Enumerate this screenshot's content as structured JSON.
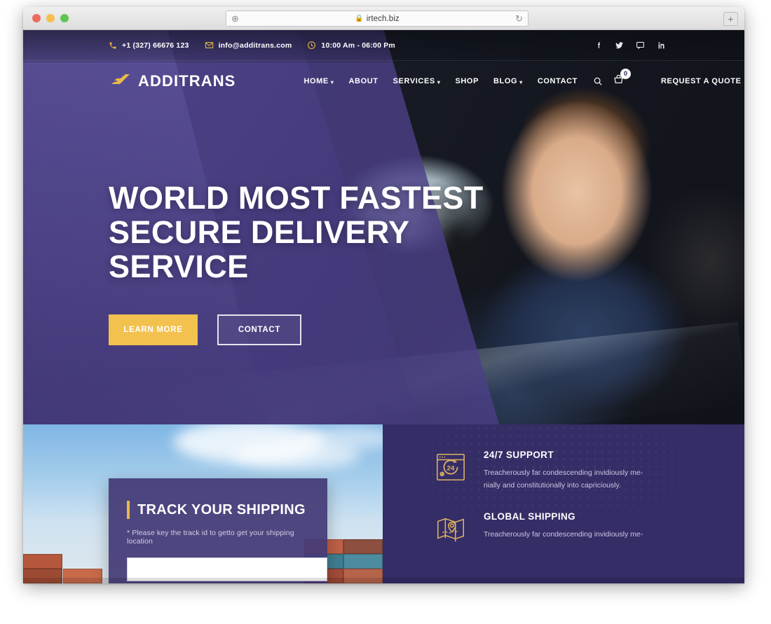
{
  "browser": {
    "url": "irtech.biz",
    "lock_icon": "lock-icon",
    "reload_icon": "reload-icon",
    "add_icon": "plus-circle-icon",
    "new_tab_icon": "plus-icon",
    "traffic_lights": [
      "close",
      "minimize",
      "maximize"
    ]
  },
  "topbar": {
    "contacts": [
      {
        "icon": "phone-icon",
        "label": "+1 (327) 66676 123"
      },
      {
        "icon": "envelope-icon",
        "label": "info@additrans.com"
      },
      {
        "icon": "clock-icon",
        "label": "10:00 Am - 06:00 Pm"
      }
    ],
    "social": [
      {
        "icon": "facebook-icon",
        "glyph": "f"
      },
      {
        "icon": "twitter-icon",
        "glyph": "t"
      },
      {
        "icon": "message-icon",
        "glyph": "m"
      },
      {
        "icon": "linkedin-icon",
        "glyph": "in"
      }
    ]
  },
  "nav": {
    "brand": "ADDITRANS",
    "brand_logo_icon": "arrow-logo-icon",
    "links": [
      {
        "label": "HOME",
        "has_dropdown": true
      },
      {
        "label": "ABOUT",
        "has_dropdown": false
      },
      {
        "label": "SERVICES",
        "has_dropdown": true
      },
      {
        "label": "SHOP",
        "has_dropdown": false
      },
      {
        "label": "BLOG",
        "has_dropdown": true
      },
      {
        "label": "CONTACT",
        "has_dropdown": false
      }
    ],
    "search_icon": "search-icon",
    "cart_icon": "cart-icon",
    "cart_count": "0",
    "quote_label": "REQUEST A QUOTE"
  },
  "hero": {
    "title_line1": "WORLD MOST FASTEST",
    "title_line2": "SECURE DELIVERY",
    "title_line3": "SERVICE",
    "primary_button": "LEARN MORE",
    "secondary_button": "CONTACT"
  },
  "track": {
    "title": "TRACK YOUR SHIPPING",
    "note": "* Please key the track id to getto get your shipping location",
    "input_value": "",
    "input_placeholder": ""
  },
  "features": [
    {
      "icon": "support-24-icon",
      "title": "24/7 SUPPORT",
      "desc": "Treacherously far condescending invidiously me-nially and constitutionally into capriciously."
    },
    {
      "icon": "global-shipping-map-icon",
      "title": "GLOBAL SHIPPING",
      "desc": "Treacherously far condescending invidiously me-"
    }
  ],
  "colors": {
    "accent_yellow": "#e9b949",
    "brand_purple": "#4a3f86",
    "panel_purple": "#352d66",
    "card_purple": "#443a76"
  }
}
